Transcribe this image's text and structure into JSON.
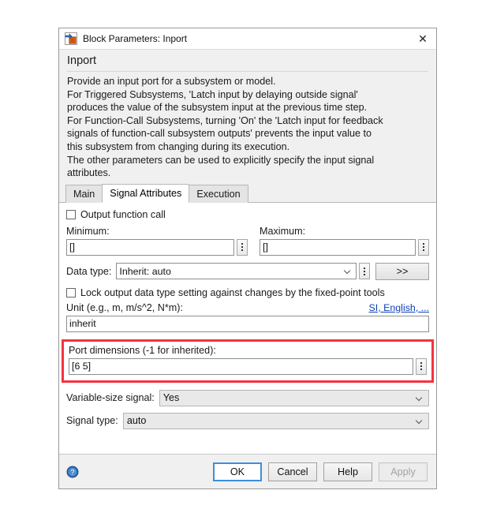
{
  "window": {
    "title": "Block Parameters: Inport",
    "icon": "simulink-block-icon",
    "close_label": "✕"
  },
  "header": {
    "block_name": "Inport",
    "description": "Provide an input port for a subsystem or model.\nFor Triggered Subsystems, 'Latch input by delaying outside signal'\nproduces the value of the subsystem input at the previous time step.\nFor Function-Call Subsystems, turning 'On' the 'Latch input for feedback\nsignals of function-call subsystem outputs' prevents the input value to\nthis subsystem from changing during its execution.\nThe other parameters can be used to explicitly specify the input signal\nattributes."
  },
  "tabs": [
    {
      "label": "Main",
      "active": false
    },
    {
      "label": "Signal Attributes",
      "active": true
    },
    {
      "label": "Execution",
      "active": false
    }
  ],
  "form": {
    "output_function_call": {
      "label": "Output function call",
      "checked": false
    },
    "minimum": {
      "label": "Minimum:",
      "value": "[]"
    },
    "maximum": {
      "label": "Maximum:",
      "value": "[]"
    },
    "data_type": {
      "label": "Data type:",
      "value": "Inherit: auto",
      "expand_button": ">>"
    },
    "lock_output": {
      "label": "Lock output data type setting against changes by the fixed-point tools",
      "checked": false
    },
    "unit": {
      "label": "Unit (e.g., m, m/s^2, N*m):",
      "link": "SI, English, ...",
      "value": "inherit"
    },
    "port_dimensions": {
      "label": "Port dimensions (-1 for inherited):",
      "value": "[6 5]",
      "highlighted": true,
      "highlight_color": "#f5333f"
    },
    "variable_size_signal": {
      "label": "Variable-size signal:",
      "value": "Yes"
    },
    "signal_type": {
      "label": "Signal type:",
      "value": "auto"
    }
  },
  "footer": {
    "help_icon": "help-circle-icon",
    "ok": "OK",
    "cancel": "Cancel",
    "help": "Help",
    "apply": "Apply",
    "apply_disabled": true
  }
}
